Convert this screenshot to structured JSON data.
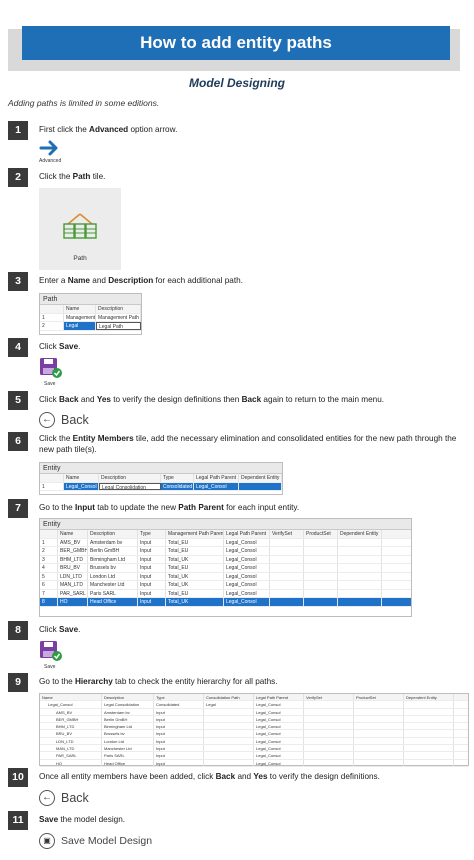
{
  "header": {
    "title": "How to add entity paths",
    "subtitle": "Model Designing",
    "note": "Adding paths is limited in some editions."
  },
  "steps": [
    {
      "num": "1",
      "pre": "First click the ",
      "b1": "Advanced",
      "mid": " option arrow.",
      "b2": "",
      "post": ""
    },
    {
      "num": "2",
      "pre": "Click the ",
      "b1": "Path",
      "mid": " tile.",
      "b2": "",
      "post": ""
    },
    {
      "num": "3",
      "pre": "Enter a ",
      "b1": "Name",
      "mid": " and ",
      "b2": "Description",
      "post": " for each additional path."
    },
    {
      "num": "4",
      "pre": "Click ",
      "b1": "Save",
      "mid": ".",
      "b2": "",
      "post": ""
    },
    {
      "num": "5",
      "pre": "Click ",
      "b1": "Back",
      "mid": " and ",
      "b2": "Yes",
      "post": " to verify the design definitions then ",
      "b3": "Back",
      "post2": " again to return to the main menu."
    },
    {
      "num": "6",
      "pre": "Click the ",
      "b1": "Entity Members",
      "mid": " tile, add the necessary elimination and consolidated entities for the new path through the new path tile(s).",
      "b2": "",
      "post": ""
    },
    {
      "num": "7",
      "pre": "Go to the ",
      "b1": "Input",
      "mid": " tab to update the new ",
      "b2": "Path Parent",
      "post": " for each input entity."
    },
    {
      "num": "8",
      "pre": "Click ",
      "b1": "Save",
      "mid": ".",
      "b2": "",
      "post": ""
    },
    {
      "num": "9",
      "pre": "Go to the ",
      "b1": "Hierarchy",
      "mid": " tab to check the entity hierarchy for all paths.",
      "b2": "",
      "post": ""
    },
    {
      "num": "10",
      "pre": "Once all entity members have been added, click ",
      "b1": "Back",
      "mid": " and ",
      "b2": "Yes",
      "post": " to verify the design definitions."
    },
    {
      "num": "11",
      "pre": "",
      "b1": "Save",
      "mid": " the model design.",
      "b2": "",
      "post": ""
    }
  ],
  "icons": {
    "advanced_label": "Advanced",
    "path_tile_label": "Path",
    "save_label": "Save",
    "back_label": "Back",
    "save_model_label": "Save Model Design",
    "accent": "#1f6fb6",
    "save_icon_color": "#7b3fa3",
    "check_color": "#2e9c46"
  },
  "path_table": {
    "title": "Path",
    "headers": [
      "",
      "Name",
      "Description"
    ],
    "rows": [
      [
        "1",
        "Management",
        "Management Path"
      ],
      [
        "2",
        "Legal",
        "Legal Path"
      ]
    ]
  },
  "entity_table1": {
    "title": "Entity",
    "headers": [
      "",
      "Name",
      "Description",
      "Type",
      "Legal Path Parent",
      "Dependent Entity"
    ],
    "rows": [
      [
        "1",
        "Legal_Consol",
        "Legal Consolidation",
        "Consolidated",
        "Legal_Consol",
        ""
      ]
    ]
  },
  "entity_table2": {
    "title": "Entity",
    "headers": [
      "",
      "Name",
      "Description",
      "Type",
      "Management Path Parent",
      "Legal Path Parent",
      "VerifySet",
      "ProductSet",
      "Dependent Entity"
    ],
    "rows": [
      [
        "1",
        "AMS_BV",
        "Amsterdam bv",
        "Input",
        "Total_EU",
        "Legal_Consol",
        "",
        "",
        ""
      ],
      [
        "2",
        "BER_GMBH",
        "Berlin GmBH",
        "Input",
        "Total_EU",
        "Legal_Consol",
        "",
        "",
        ""
      ],
      [
        "3",
        "BHM_LTD",
        "Birmingham Ltd",
        "Input",
        "Total_UK",
        "Legal_Consol",
        "",
        "",
        ""
      ],
      [
        "4",
        "BRU_BV",
        "Brussels bv",
        "Input",
        "Total_EU",
        "Legal_Consol",
        "",
        "",
        ""
      ],
      [
        "5",
        "LDN_LTD",
        "London Ltd",
        "Input",
        "Total_UK",
        "Legal_Consol",
        "",
        "",
        ""
      ],
      [
        "6",
        "MAN_LTD",
        "Manchester Ltd",
        "Input",
        "Total_UK",
        "Legal_Consol",
        "",
        "",
        ""
      ],
      [
        "7",
        "PAR_SARL",
        "Paris SARL",
        "Input",
        "Total_EU",
        "Legal_Consol",
        "",
        "",
        ""
      ],
      [
        "8",
        "HO",
        "Head Office",
        "Input",
        "Total_UK",
        "Legal_Consol",
        "",
        "",
        ""
      ]
    ]
  },
  "hierarchy_table": {
    "headers": [
      "Name",
      "Description",
      "Type",
      "Consolidation Path",
      "Legal Path Parent",
      "VerifySet",
      "ProductSet",
      "Dependent Entity"
    ],
    "rows": [
      [
        "Legal_Consol",
        "Legal Consolidation",
        "Consolidated",
        "Legal",
        "Legal_Consol",
        "",
        "",
        ""
      ],
      [
        "AMS_BV",
        "Amsterdam bv",
        "Input",
        "",
        "Legal_Consol",
        "",
        "",
        ""
      ],
      [
        "BER_GMBH",
        "Berlin GmBH",
        "Input",
        "",
        "Legal_Consol",
        "",
        "",
        ""
      ],
      [
        "BHM_LTD",
        "Birmingham Ltd",
        "Input",
        "",
        "Legal_Consol",
        "",
        "",
        ""
      ],
      [
        "BRU_BV",
        "Brussels bv",
        "Input",
        "",
        "Legal_Consol",
        "",
        "",
        ""
      ],
      [
        "LDN_LTD",
        "London Ltd",
        "Input",
        "",
        "Legal_Consol",
        "",
        "",
        ""
      ],
      [
        "MAN_LTD",
        "Manchester Ltd",
        "Input",
        "",
        "Legal_Consol",
        "",
        "",
        ""
      ],
      [
        "PAR_SARL",
        "Paris SARL",
        "Input",
        "",
        "Legal_Consol",
        "",
        "",
        ""
      ],
      [
        "HO",
        "Head Office",
        "Input",
        "",
        "Legal_Consol",
        "",
        "",
        ""
      ]
    ]
  }
}
